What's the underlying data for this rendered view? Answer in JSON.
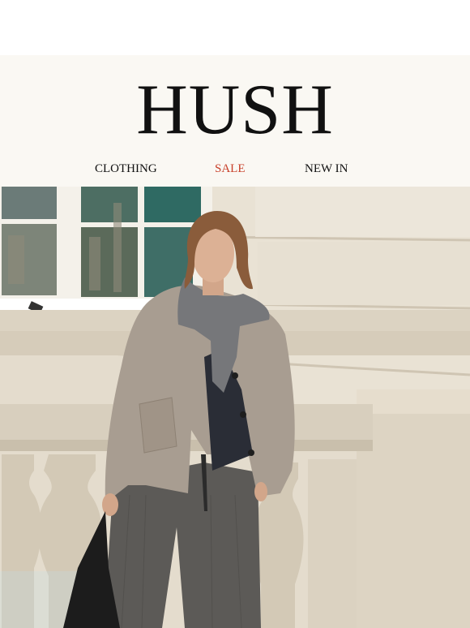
{
  "brand": {
    "logo_text": "HUSH"
  },
  "nav": {
    "items": [
      {
        "label": "CLOTHING"
      },
      {
        "label": "SALE"
      },
      {
        "label": "NEW IN"
      }
    ]
  },
  "colors": {
    "header_bg": "#faf8f3",
    "sale": "#c8402a",
    "text": "#111111"
  },
  "hero": {
    "icon": "hero-photo-woman-in-coat"
  }
}
